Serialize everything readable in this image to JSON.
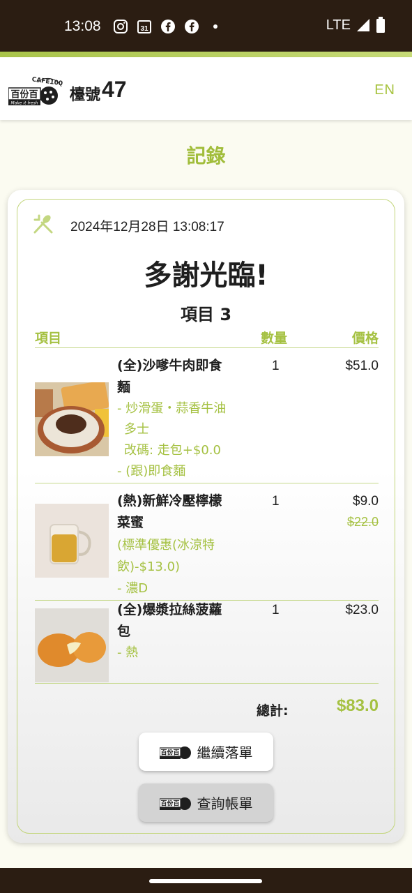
{
  "status_bar": {
    "time": "13:08",
    "network": "LTE",
    "icons": [
      "instagram-icon",
      "calendar-icon",
      "facebook-icon",
      "facebook-icon",
      "dot-icon",
      "signal-icon",
      "battery-icon"
    ],
    "calendar_day": "31"
  },
  "header": {
    "logo_text": "百份百",
    "logo_script": "CAFE100%",
    "logo_tagline": "Make it fresh",
    "table_label": "檯號",
    "table_number": "47",
    "lang_toggle": "EN"
  },
  "page_title": "記錄",
  "receipt": {
    "datetime": "2024年12月28日 13:08:17",
    "thanks": "多謝光臨!",
    "item_count": "項目 3",
    "columns": {
      "item": "項目",
      "qty": "數量",
      "price": "價格"
    },
    "items": [
      {
        "name_line1": "(全)沙嗲牛肉即食",
        "name_line2": "麵",
        "options": [
          "- 炒滑蛋・蒜香牛油",
          "  多士",
          "  改碼: 走包+$0.0",
          "- (跟)即食麵"
        ],
        "qty": "1",
        "price": "$51.0",
        "image": "satay-beef-noodle-set-photo"
      },
      {
        "name_line1": "(熱)新鮮冷壓檸檬",
        "name_line2": "菜蜜",
        "options": [
          "(標準優惠(冰涼特",
          "飲)-$13.0)",
          "- 濃D"
        ],
        "qty": "1",
        "price": "$9.0",
        "original_price": "$22.0",
        "image": "lemon-honey-tea-photo"
      },
      {
        "name_line1": "(全)爆漿拉絲菠蘿",
        "name_line2": "包",
        "options": [
          "- 熱"
        ],
        "qty": "1",
        "price": "$23.0",
        "image": "cheese-pineapple-bun-photo"
      }
    ],
    "total_label": "總計:",
    "total_value": "$83.0"
  },
  "buttons": {
    "continue_order": "繼續落單",
    "check_bill": "查詢帳單"
  },
  "colors": {
    "accent_green": "#a5c142",
    "status_bar_bg": "#2b1d12",
    "page_bg": "#fbfbf1"
  }
}
